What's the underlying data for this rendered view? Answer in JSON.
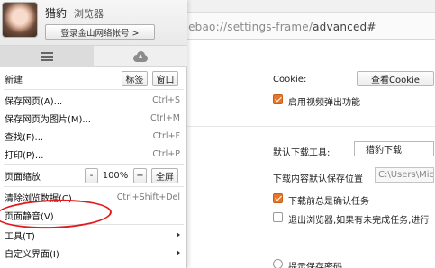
{
  "settings_page": {
    "url_host": "liebao://settings-frame/",
    "url_path": "advanced#",
    "cookie_label": "Cookie:",
    "view_cookie_button": "查看Cookie",
    "enable_popup_label": "启用视频弹出功能",
    "default_downloader_label": "默认下载工具:",
    "default_downloader_value": "猎豹下载",
    "download_location_label": "下载内容默认保存位置",
    "download_location_value": "C:\\Users\\Mic",
    "confirm_task_label": "下载前总是确认任务",
    "exit_prompt_label": "退出浏览器,如果有未完成任务,进行",
    "prompt_save_password_label": "提示保存密码"
  },
  "menu": {
    "brand": "猎豹",
    "brand_name": "浏览器",
    "login_button": "登录金山网络帐号 >",
    "new_label": "新建",
    "new_tab_button": "标签",
    "new_window_button": "窗口",
    "items": [
      {
        "label": "保存网页(A)...",
        "shortcut": "Ctrl+S"
      },
      {
        "label": "保存网页为图片(M)...",
        "shortcut": "Ctrl+M"
      },
      {
        "label": "查找(F)...",
        "shortcut": "Ctrl+F"
      },
      {
        "label": "打印(P)...",
        "shortcut": "Ctrl+P"
      }
    ],
    "zoom": {
      "label": "页面缩放",
      "minus": "-",
      "value": "100%",
      "plus": "+",
      "fullscreen": "全屏"
    },
    "clear_data": {
      "label": "清除浏览数据(C)...",
      "shortcut": "Ctrl+Shift+Del"
    },
    "mute_page": {
      "label": "页面静音(V)"
    },
    "tools": {
      "label": "工具(T)"
    },
    "customize": {
      "label": "自定义界面(I)"
    }
  },
  "colors": {
    "annotation_circle": "#e11b1b",
    "checkbox_checked": "#e8762a"
  },
  "icons": {
    "menu_tab": "hamburger-icon",
    "cloud_tab": "cloud-upload-icon"
  }
}
